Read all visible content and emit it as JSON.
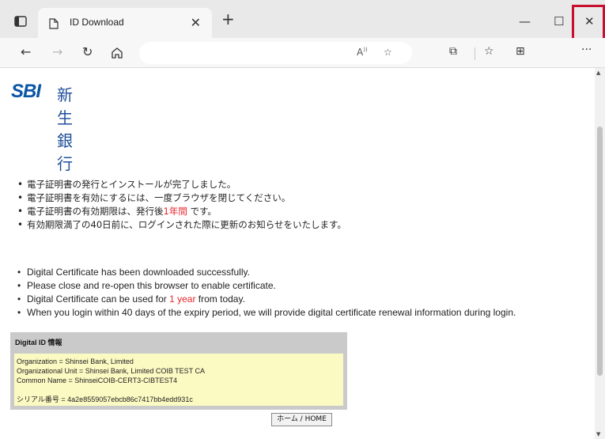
{
  "browser": {
    "tab_title": "ID Download",
    "tab_close": "✕",
    "new_tab": "+",
    "minimize": "—",
    "maximize": "☐",
    "close": "✕",
    "menu": "···"
  },
  "logo": {
    "brand": "SBI",
    "bank_name": "新生銀行"
  },
  "messages_jp": [
    {
      "text": "電子証明書の発行とインストールが完了しました。"
    },
    {
      "text": "電子証明書を有効にするには、一度ブラウザを閉じてください。"
    },
    {
      "before": "電子証明書の有効期限は、発行後",
      "highlight": "1年間",
      "after": " です。"
    },
    {
      "text": "有効期限満了の40日前に、ログインされた際に更新のお知らせをいたします。"
    }
  ],
  "messages_en": [
    {
      "text": "Digital Certificate has been downloaded successfully."
    },
    {
      "text": "Please close and re-open this browser to enable certificate."
    },
    {
      "before": "Digital Certificate can be used for ",
      "highlight": "1 year",
      "after": " from today."
    },
    {
      "text": "When you login within 40 days of the expiry period, we will provide digital certificate renewal information during login."
    }
  ],
  "digital_id": {
    "title": "Digital ID 情報",
    "organization": "Organization = Shinsei Bank, Limited",
    "organizational_unit": "Organizational Unit = Shinsei Bank, Limited COIB TEST CA",
    "common_name": "Common Name = ShinseiCOIB-CERT3-CIBTEST4",
    "serial": "シリアル番号 = 4a2e8559057ebcb86c7417bb4edd931c"
  },
  "home_button": "ホーム / HOME",
  "colors": {
    "highlight_red": "#e8262d",
    "brand_blue": "#0b56a5",
    "id_box_yellow": "#fcfac3",
    "close_outline": "#c8102e"
  }
}
